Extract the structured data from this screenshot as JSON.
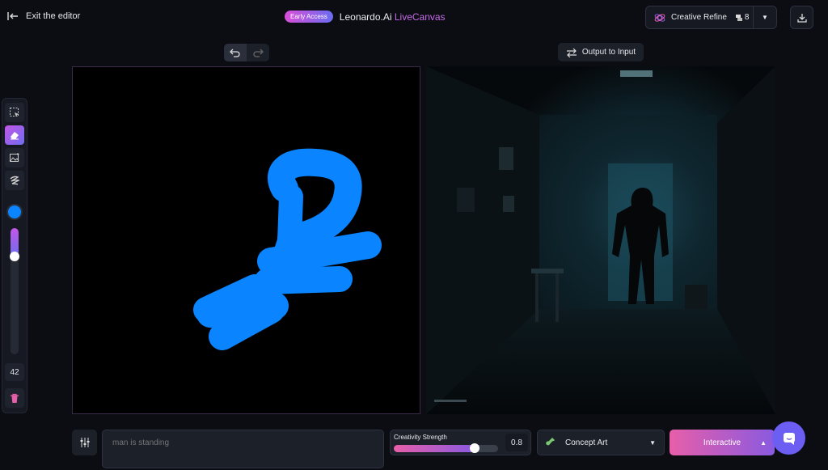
{
  "header": {
    "exit_label": "Exit the editor",
    "badge": "Early Access",
    "app_name": "Leonardo.Ai",
    "app_accent": "LiveCanvas",
    "refine_label": "Creative Refine",
    "refine_count": "8"
  },
  "canvas_controls": {
    "output_to_input": "Output to Input"
  },
  "toolbar": {
    "brush_color": "#0a84ff",
    "brush_size": "42",
    "brush_size_level": 0.2
  },
  "bottom": {
    "prompt_placeholder": "man is standing",
    "creativity_label": "Creativity Strength",
    "creativity_value": "0.8",
    "creativity_level": 0.8,
    "style": "Concept Art",
    "generate_mode": "Interactive"
  },
  "colors": {
    "accent_pink": "#e75ea9",
    "accent_purple": "#8a5ae0",
    "brush_blue": "#0a84ff",
    "chat": "#6c5ef2"
  }
}
